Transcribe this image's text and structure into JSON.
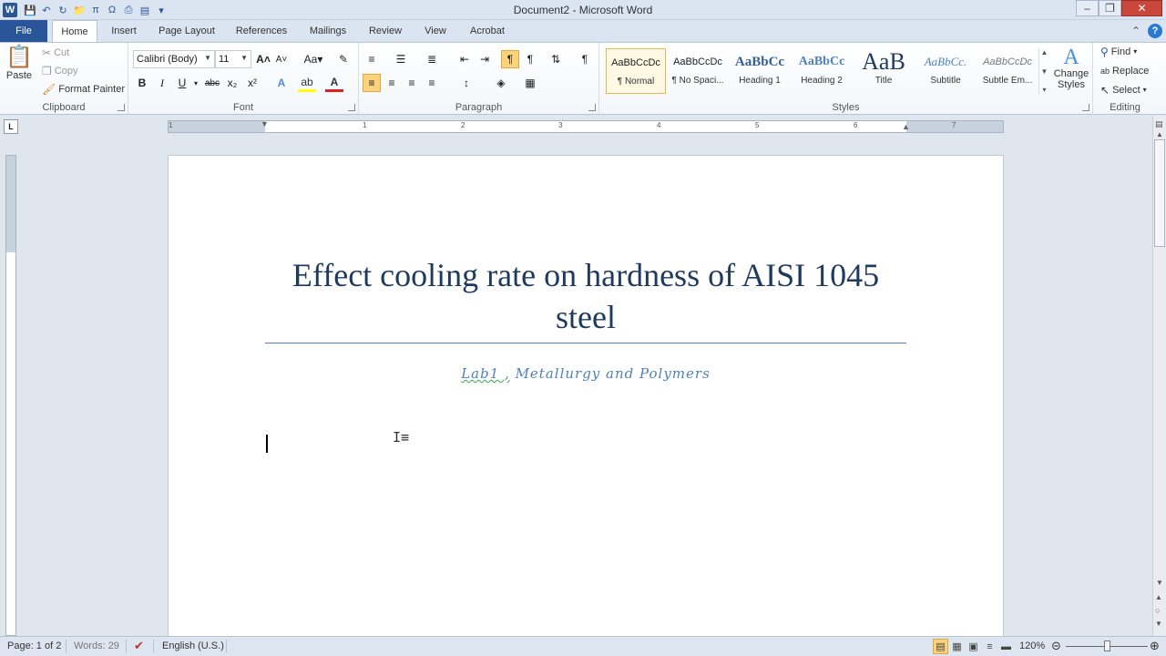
{
  "window": {
    "title": "Document2  -  Microsoft Word",
    "app_icon_letter": "W"
  },
  "qat": {
    "icons": [
      "save-icon",
      "undo-icon",
      "redo-icon",
      "open-folder-icon",
      "equation-icon",
      "symbol-icon",
      "print-icon",
      "export-icon"
    ]
  },
  "tabs": {
    "file": "File",
    "items": [
      "Home",
      "Insert",
      "Page Layout",
      "References",
      "Mailings",
      "Review",
      "View",
      "Acrobat"
    ],
    "active": "Home"
  },
  "clipboard": {
    "paste": "Paste",
    "cut": "Cut",
    "copy": "Copy",
    "format_painter": "Format Painter",
    "label": "Clipboard"
  },
  "font": {
    "family": "Calibri (Body)",
    "size": "11",
    "label": "Font"
  },
  "paragraph": {
    "label": "Paragraph"
  },
  "styles": {
    "label": "Styles",
    "gallery": [
      {
        "sample": "AaBbCcDc",
        "name": "¶ Normal"
      },
      {
        "sample": "AaBbCcDc",
        "name": "¶ No Spaci..."
      },
      {
        "sample": "AaBbCc",
        "name": "Heading 1"
      },
      {
        "sample": "AaBbCc",
        "name": "Heading 2"
      },
      {
        "sample": "AaB",
        "name": "Title"
      },
      {
        "sample": "AaBbCc.",
        "name": "Subtitle"
      },
      {
        "sample": "AaBbCcDc",
        "name": "Subtle Em..."
      }
    ],
    "change_styles": "Change Styles"
  },
  "editing": {
    "find": "Find",
    "replace": "Replace",
    "select": "Select",
    "label": "Editing"
  },
  "ruler": {
    "ticks": [
      "1",
      "1",
      "2",
      "3",
      "4",
      "5",
      "6",
      "7"
    ],
    "corner": "L"
  },
  "document": {
    "title": "Effect cooling rate on hardness of AISI 1045 steel",
    "subtitle_squiggle": "Lab1 ,",
    "subtitle_rest": " Metallurgy and Polymers"
  },
  "status": {
    "page": "Page: 1 of 2",
    "words": "Words: 29",
    "language": "English (U.S.)",
    "zoom": "120%"
  },
  "colors": {
    "file_tab": "#2a5699",
    "title_text": "#1f3a5f",
    "subtitle_text": "#4f81bd",
    "active_highlight": "#fbd27d"
  }
}
